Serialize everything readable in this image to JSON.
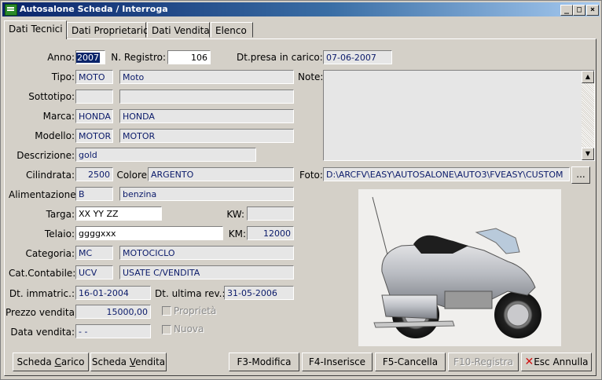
{
  "window": {
    "title": "Autosalone Scheda / Interroga",
    "minimize": "_",
    "maximize": "□",
    "close": "×"
  },
  "tabs": [
    "Dati Tecnici",
    "Dati Proprietario",
    "Dati Vendita",
    "Elenco"
  ],
  "form": {
    "anno": {
      "label": "Anno:",
      "value": "2007"
    },
    "registro": {
      "label": "N. Registro:",
      "value": "106"
    },
    "presa": {
      "label": "Dt.presa in carico:",
      "value": "07-06-2007"
    },
    "tipo": {
      "label": "Tipo:",
      "code": "MOTO",
      "desc": "Moto"
    },
    "sottotipo": {
      "label": "Sottotipo:",
      "code": "",
      "desc": ""
    },
    "marca": {
      "label": "Marca:",
      "code": "HONDA",
      "desc": "HONDA"
    },
    "modello": {
      "label": "Modello:",
      "code": "MOTOR",
      "desc": "MOTOR"
    },
    "descrizione": {
      "label": "Descrizione:",
      "value": "gold"
    },
    "cilindrata": {
      "label": "Cilindrata:",
      "value": "2500"
    },
    "colore": {
      "label": "Colore",
      "value": "ARGENTO"
    },
    "alimentazione": {
      "label": "Alimentazione:",
      "code": "B",
      "desc": "benzina"
    },
    "targa": {
      "label": "Targa:",
      "value": "XX YY ZZ"
    },
    "kw": {
      "label": "KW:",
      "value": ""
    },
    "telaio": {
      "label": "Telaio:",
      "value": "ggggxxx"
    },
    "km": {
      "label": "KM:",
      "value": "12000"
    },
    "categoria": {
      "label": "Categoria:",
      "code": "MC",
      "desc": "MOTOCICLO"
    },
    "catcontabile": {
      "label": "Cat.Contabile:",
      "code": "UCV",
      "desc": "USATE C/VENDITA"
    },
    "immatric": {
      "label": "Dt. immatric.:",
      "value": "16-01-2004"
    },
    "ultimarev": {
      "label": "Dt. ultima rev.:",
      "value": "31-05-2006"
    },
    "prezzo": {
      "label": "Prezzo vendita:",
      "value": "15000,00"
    },
    "datavendita": {
      "label": "Data vendita:",
      "value": "-  -"
    },
    "proprieta": {
      "label": "Proprietà"
    },
    "nuova": {
      "label": "Nuova"
    },
    "note": {
      "label": "Note:"
    },
    "foto": {
      "label": "Foto:",
      "value": "D:\\ARCFV\\EASY\\AUTOSALONE\\AUTO3\\FVEASY\\CUSTOM",
      "browse": "..."
    }
  },
  "buttons": {
    "scheda_carico": {
      "pre": "Scheda ",
      "u": "C",
      "post": "arico"
    },
    "scheda_vendita": {
      "pre": "Scheda ",
      "u": "V",
      "post": "endita"
    },
    "modifica": "F3-Modifica",
    "inserisce": "F4-Inserisce",
    "cancella": "F5-Cancella",
    "registra": "F10-Registra",
    "annulla": "Esc Annulla"
  }
}
